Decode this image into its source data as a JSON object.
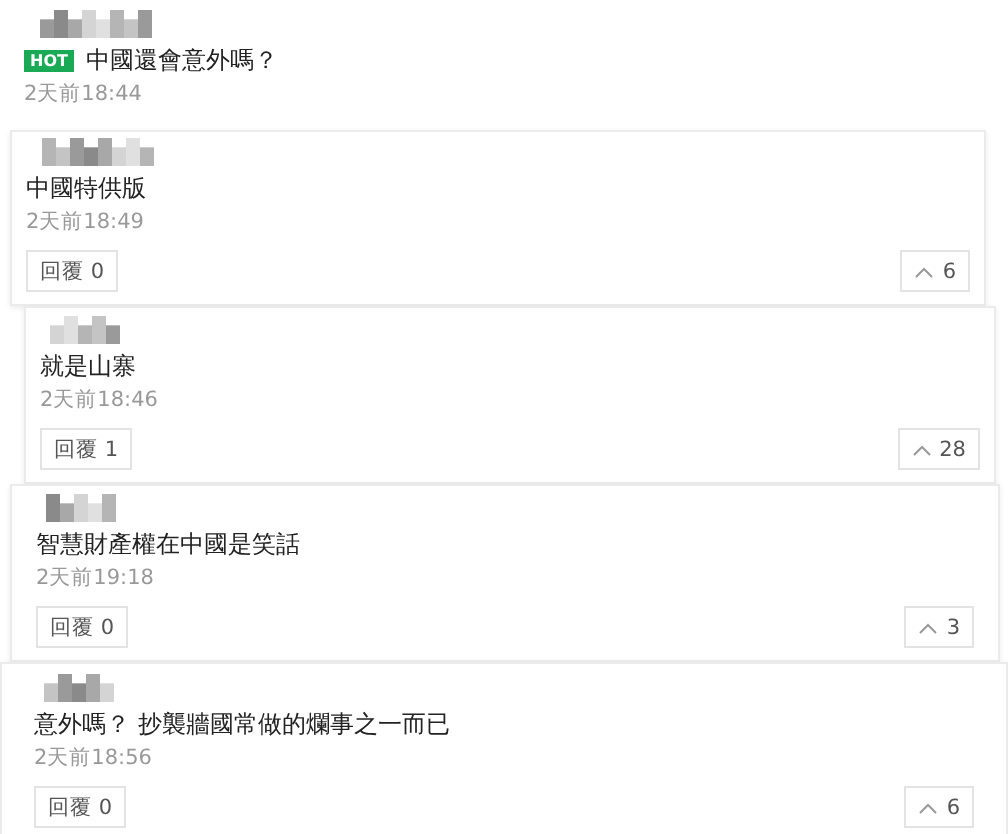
{
  "comments": [
    {
      "badge": "HOT",
      "text": "中國還會意外嗎？",
      "time": "2天前18:44"
    },
    {
      "text": "中國特供版",
      "time": "2天前18:49",
      "reply_label": "回覆",
      "reply_count": "0",
      "upvotes": "6"
    },
    {
      "text": "就是山寨",
      "time": "2天前18:46",
      "reply_label": "回覆",
      "reply_count": "1",
      "upvotes": "28"
    },
    {
      "text": "智慧財產權在中國是笑話",
      "time": "2天前19:18",
      "reply_label": "回覆",
      "reply_count": "0",
      "upvotes": "3"
    },
    {
      "text": "意外嗎？ 抄襲牆國常做的爛事之一而已",
      "time": "2天前18:56",
      "reply_label": "回覆",
      "reply_count": "0",
      "upvotes": "6"
    }
  ]
}
